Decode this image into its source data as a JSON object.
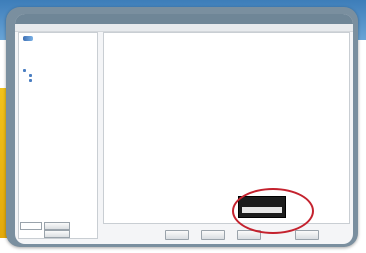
{
  "window": {
    "title_segments": [
      "",
      "",
      ""
    ]
  },
  "tree": {
    "items": [
      {
        "label": "",
        "indent": 1
      },
      {
        "label": "",
        "indent": 1
      },
      {
        "label": "",
        "indent": 1
      },
      {
        "label": "",
        "indent": 1
      },
      {
        "label": "",
        "indent": 0
      },
      {
        "label": "",
        "indent": 1
      },
      {
        "label": "",
        "indent": 1
      }
    ]
  },
  "left_bottom": {
    "label": "",
    "input_value": "",
    "button_1": "",
    "button_2": ""
  },
  "list": {
    "rows": [
      [
        "",
        "",
        ""
      ],
      [
        "",
        "",
        ""
      ],
      [
        "",
        "",
        ""
      ],
      [
        "",
        "",
        ""
      ]
    ]
  },
  "footer": {
    "buttons": [
      "",
      "",
      "",
      ""
    ]
  },
  "readout": {
    "line1": "",
    "line2": ""
  },
  "colors": {
    "highlight_ring": "#c4222e",
    "accent_yellow": "#f2c21a",
    "accent_blue": "#3d7db9"
  }
}
